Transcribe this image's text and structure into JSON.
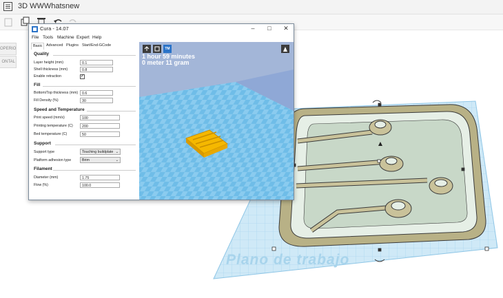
{
  "app": {
    "title": "3D WWWhatsnew",
    "side_buttons": [
      "OPERIOR",
      "ONTAL"
    ],
    "workplane_label": "Plano de trabajo"
  },
  "cura": {
    "window_title": "Cura - 14.07",
    "menu": [
      "File",
      "Tools",
      "Machine",
      "Expert",
      "Help"
    ],
    "tabs": [
      "Basic",
      "Advanced",
      "Plugins",
      "Start/End-GCode"
    ],
    "quality": {
      "heading": "Quality",
      "layer_height_label": "Layer height (mm)",
      "layer_height": "0.1",
      "shell_thickness_label": "Shell thickness (mm)",
      "shell_thickness": "0.8",
      "retraction_label": "Enable retraction",
      "retraction_check": "✓"
    },
    "fill": {
      "heading": "Fill",
      "bottom_top_label": "Bottom/Top thickness (mm)",
      "bottom_top": "0.6",
      "density_label": "Fill Density (%)",
      "density": "30"
    },
    "speed": {
      "heading": "Speed and Temperature",
      "print_speed_label": "Print speed (mm/s)",
      "print_speed": "100",
      "print_temp_label": "Printing temperature (C)",
      "print_temp": "200",
      "bed_temp_label": "Bed temperature (C)",
      "bed_temp": "50"
    },
    "support": {
      "heading": "Support",
      "type_label": "Support type",
      "type": "Touching buildplate",
      "adhesion_label": "Platform adhesion type",
      "adhesion": "Brim"
    },
    "filament": {
      "heading": "Filament",
      "diameter_label": "Diameter (mm)",
      "diameter": "1.75",
      "flow_label": "Flow (%)",
      "flow": "100.0"
    },
    "viewport": {
      "line1": "1 hour 59 minutes",
      "line2": "0 meter 11 gram",
      "badge": "TM"
    }
  },
  "colors": {
    "grid_blue": "#a9d9f2",
    "viewport_sky": "#9fb2d6",
    "floor_blue": "#6fbde8",
    "model_yellow": "#f5b800",
    "part_khaki": "#c9c29a"
  }
}
